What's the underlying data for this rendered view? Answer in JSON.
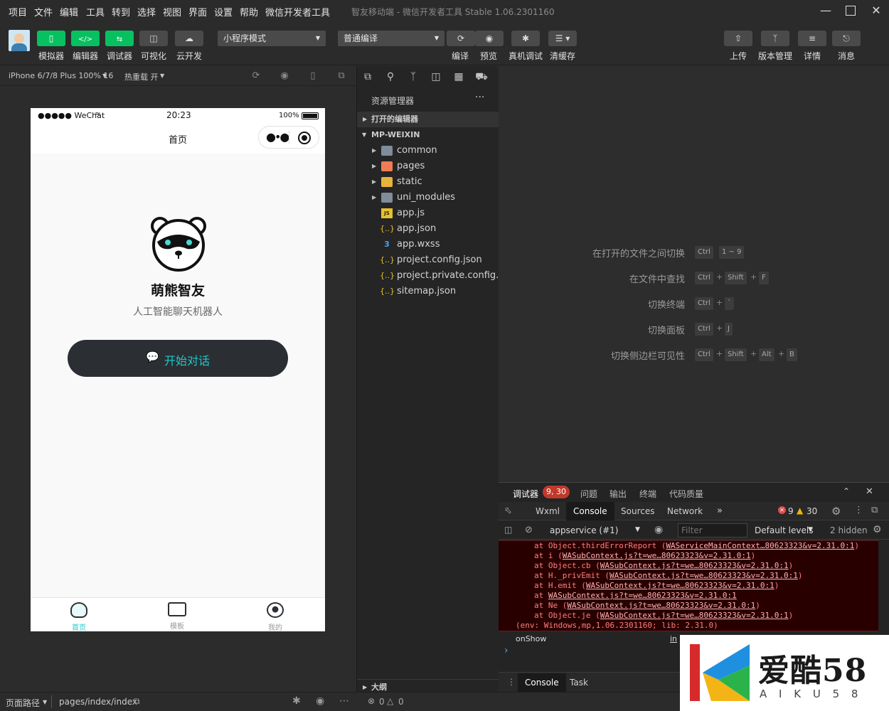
{
  "menubar": {
    "items": [
      "项目",
      "文件",
      "编辑",
      "工具",
      "转到",
      "选择",
      "视图",
      "界面",
      "设置",
      "帮助",
      "微信开发者工具"
    ],
    "window_title": "智友移动端 - 微信开发者工具 Stable 1.06.2301160"
  },
  "toolbar": {
    "left_buttons": [
      {
        "label": "模拟器",
        "icon": "phone-icon"
      },
      {
        "label": "编辑器",
        "icon": "code-icon"
      },
      {
        "label": "调试器",
        "icon": "debug-icon"
      },
      {
        "label": "可视化",
        "icon": "layout-icon"
      },
      {
        "label": "云开发",
        "icon": "cloud-icon"
      }
    ],
    "mode_select": "小程序模式",
    "compile_select": "普通编译",
    "mid_buttons": [
      {
        "label": "编译",
        "icon": "refresh-icon"
      },
      {
        "label": "预览",
        "icon": "eye-icon"
      },
      {
        "label": "真机调试",
        "icon": "bug-icon"
      },
      {
        "label": "清缓存",
        "icon": "layers-icon"
      }
    ],
    "right_buttons": [
      {
        "label": "上传",
        "icon": "upload-icon"
      },
      {
        "label": "版本管理",
        "icon": "branch-icon"
      },
      {
        "label": "详情",
        "icon": "menu-icon"
      },
      {
        "label": "消息",
        "icon": "bell-icon"
      }
    ]
  },
  "simulator": {
    "device": "iPhone 6/7/8 Plus 100% 16",
    "hot_reload": "热重载 开",
    "status": {
      "carrier": "●●●●● WeChat",
      "time": "20:23",
      "battery": "100%"
    },
    "nav_title": "首页",
    "app_name": "萌熊智友",
    "app_subtitle": "人工智能聊天机器人",
    "start_button": "开始对话",
    "tabs": [
      {
        "label": "首页",
        "icon": "home-icon",
        "active": true
      },
      {
        "label": "模板",
        "icon": "template-icon",
        "active": false
      },
      {
        "label": "我的",
        "icon": "bear-icon",
        "active": false
      }
    ],
    "accent": "#1ec8c8"
  },
  "explorer": {
    "title": "资源管理器",
    "more": "···",
    "open_editors": "打开的编辑器",
    "project": "MP-WEIXIN",
    "items": [
      {
        "name": "common",
        "type": "folder",
        "icon": "folder-icon"
      },
      {
        "name": "pages",
        "type": "folder",
        "icon": "folder-pages-icon"
      },
      {
        "name": "static",
        "type": "folder",
        "icon": "folder-static-icon"
      },
      {
        "name": "uni_modules",
        "type": "folder",
        "icon": "folder-icon"
      },
      {
        "name": "app.js",
        "type": "file",
        "icon": "js-file-icon",
        "glyph": "JS"
      },
      {
        "name": "app.json",
        "type": "file",
        "icon": "json-file-icon",
        "glyph": "{..}"
      },
      {
        "name": "app.wxss",
        "type": "file",
        "icon": "css-file-icon",
        "glyph": "3"
      },
      {
        "name": "project.config.json",
        "type": "file",
        "icon": "json-file-icon",
        "glyph": "{..}"
      },
      {
        "name": "project.private.config.js...",
        "type": "file",
        "icon": "json-file-icon",
        "glyph": "{..}"
      },
      {
        "name": "sitemap.json",
        "type": "file",
        "icon": "json-file-icon",
        "glyph": "{..}"
      }
    ],
    "outline": "大纲",
    "problems": {
      "errors": "0",
      "warnings": "0"
    }
  },
  "editor": {
    "shortcuts": [
      {
        "label": "在打开的文件之间切换",
        "keys": [
          "Ctrl",
          "1 ~ 9"
        ]
      },
      {
        "label": "在文件中查找",
        "keys": [
          "Ctrl",
          "+",
          "Shift",
          "+",
          "F"
        ]
      },
      {
        "label": "切换终端",
        "keys": [
          "Ctrl",
          "+",
          "`"
        ]
      },
      {
        "label": "切换面板",
        "keys": [
          "Ctrl",
          "+",
          "J"
        ]
      },
      {
        "label": "切换侧边栏可见性",
        "keys": [
          "Ctrl",
          "+",
          "Shift",
          "+",
          "Alt",
          "+",
          "B"
        ]
      }
    ]
  },
  "debugger": {
    "tabs": [
      "调试器",
      "问题",
      "输出",
      "终端",
      "代码质量"
    ],
    "badge": "9, 30",
    "devtools_tabs": [
      "Wxml",
      "Console",
      "Sources",
      "Network"
    ],
    "more_tabs": "»",
    "error_count": "9",
    "warning_count": "30",
    "context": "appservice (#1)",
    "filter_placeholder": "Filter",
    "levels": "Default levels",
    "hidden": "2 hidden",
    "stack": [
      {
        "prefix": "at Object.thirdErrorReport (",
        "link": "WAServiceMainContext…80623323&v=2.31.0:1",
        "suffix": ")"
      },
      {
        "prefix": "at i (",
        "link": "WASubContext.js?t=we…80623323&v=2.31.0:1",
        "suffix": ")"
      },
      {
        "prefix": "at Object.cb (",
        "link": "WASubContext.js?t=we…80623323&v=2.31.0:1",
        "suffix": ")"
      },
      {
        "prefix": "at H._privEmit (",
        "link": "WASubContext.js?t=we…80623323&v=2.31.0:1",
        "suffix": ")"
      },
      {
        "prefix": "at H.emit (",
        "link": "WASubContext.js?t=we…80623323&v=2.31.0:1",
        "suffix": ")"
      },
      {
        "prefix": "at ",
        "link": "WASubContext.js?t=we…80623323&v=2.31.0:1",
        "suffix": ""
      },
      {
        "prefix": "at Ne (",
        "link": "WASubContext.js?t=we…80623323&v=2.31.0:1",
        "suffix": ")"
      },
      {
        "prefix": "at Object.je (",
        "link": "WASubContext.js?t=we…80623323&v=2.31.0:1",
        "suffix": ")"
      }
    ],
    "env_line": "(env: Windows,mp,1.06.2301160; lib: 2.31.0)",
    "onshow": "onShow",
    "onshow_link": "in",
    "prompt": "›",
    "drawer_tabs": [
      "Console",
      "Task"
    ]
  },
  "statusbar": {
    "page_path_label": "页面路径",
    "page_path": "pages/index/index"
  },
  "watermark": {
    "brand": "爱酷58",
    "sub": "A I K U 5 8"
  }
}
